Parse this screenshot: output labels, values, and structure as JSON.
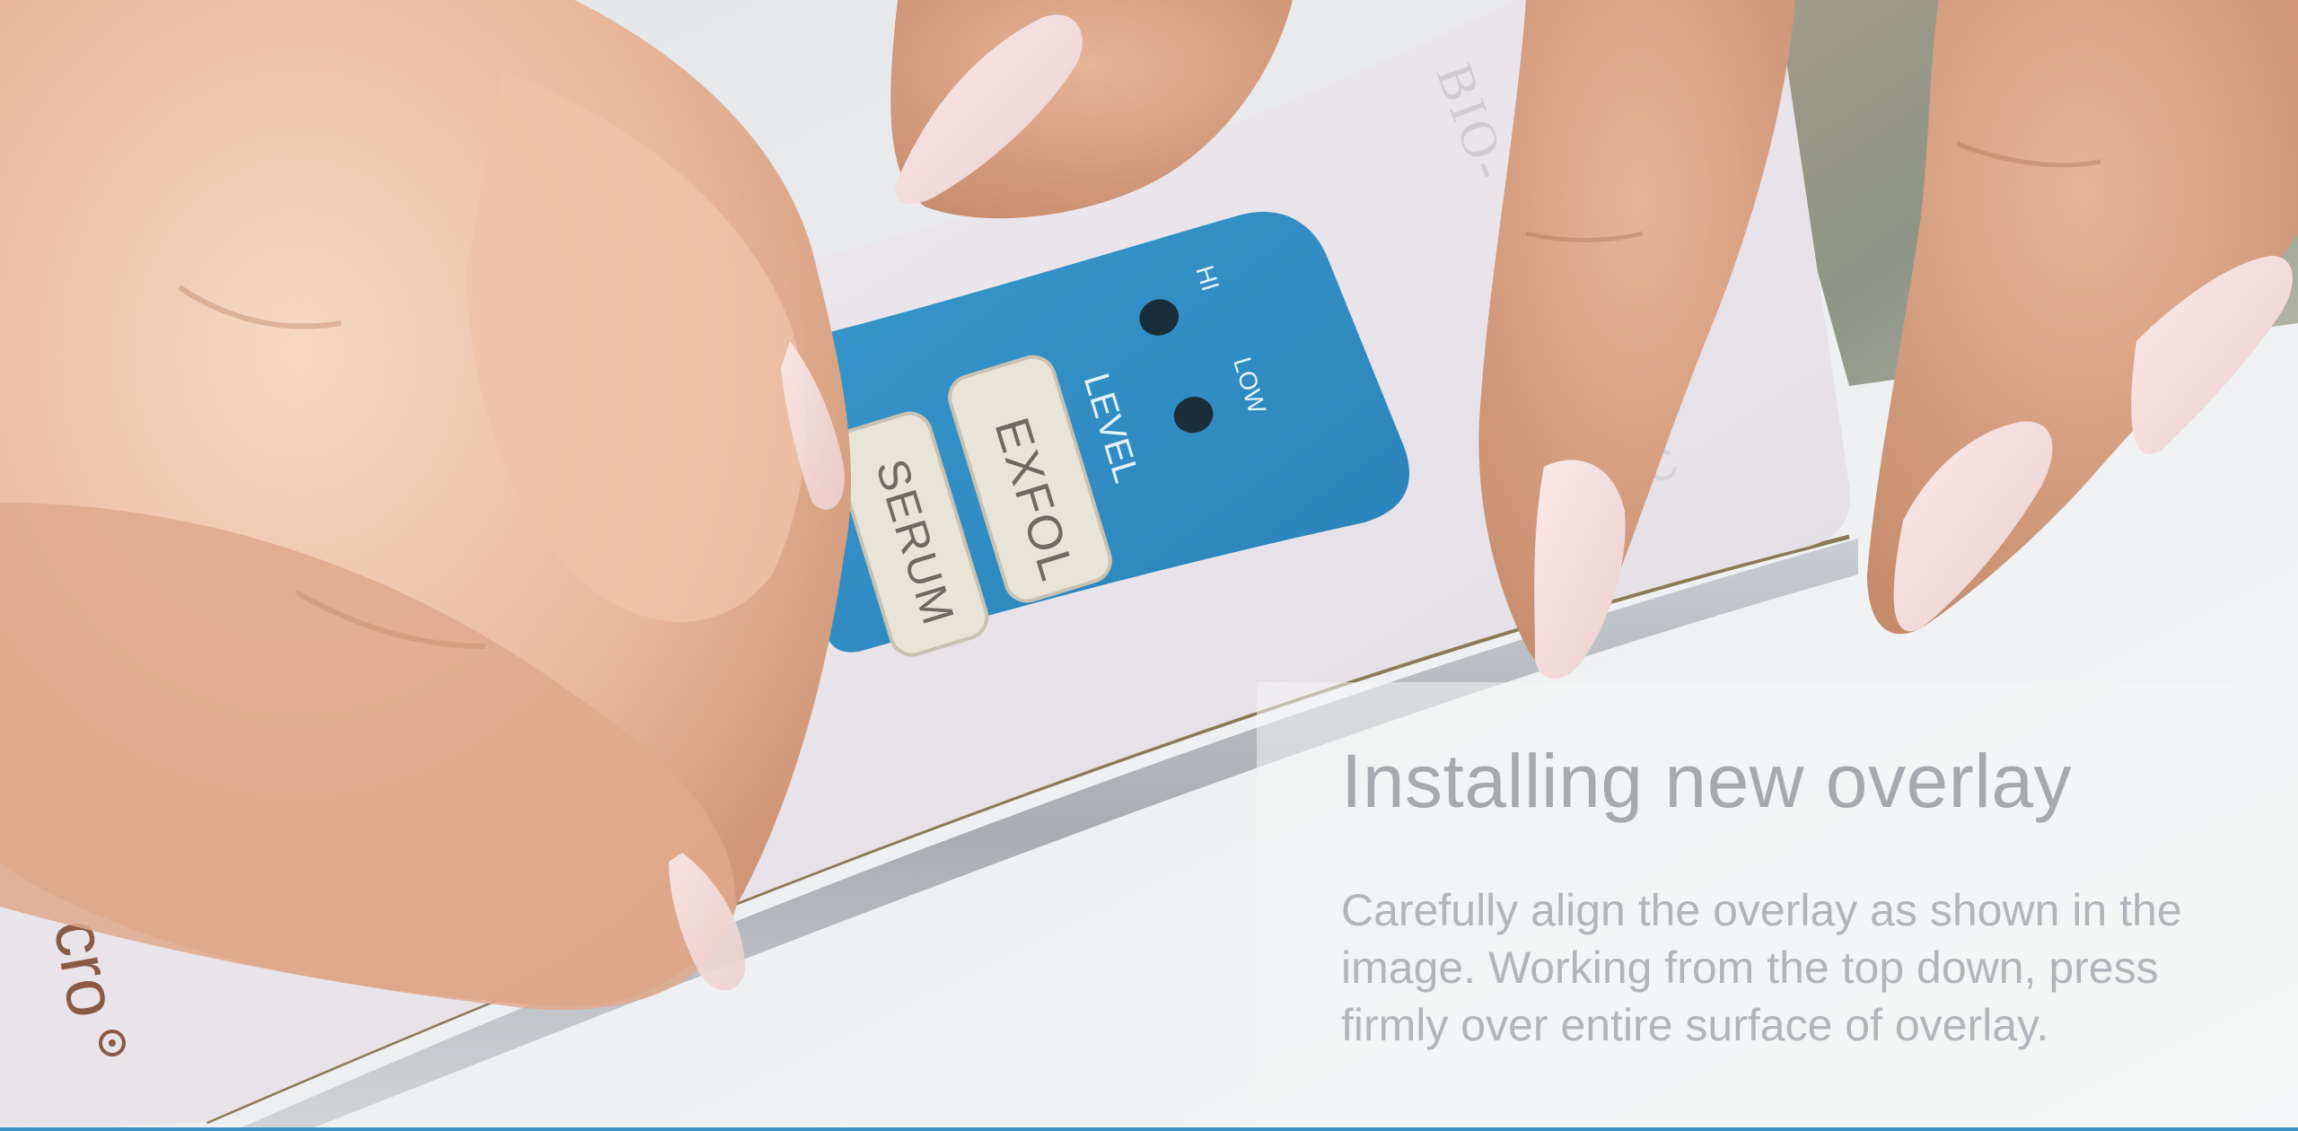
{
  "device": {
    "brand_top": "BIO-",
    "brand_bottom": "cro",
    "registered": "®",
    "side_letter": "C",
    "overlay": {
      "hi": "HI",
      "low": "LOW",
      "level": "LEVEL",
      "exfol": "EXFOL",
      "serum": "SERUM"
    }
  },
  "caption": {
    "title": "Installing new overlay",
    "body": "Carefully align the overlay as shown in the image.  Working from the top down, press firmly over entire surface of overlay."
  },
  "colors": {
    "overlay_blue": "#2f8dc4",
    "button_fill": "#e9e4d8",
    "skin": "#e8b79b",
    "nail": "#f2d6d6",
    "accent_rule": "#3a93c4"
  }
}
